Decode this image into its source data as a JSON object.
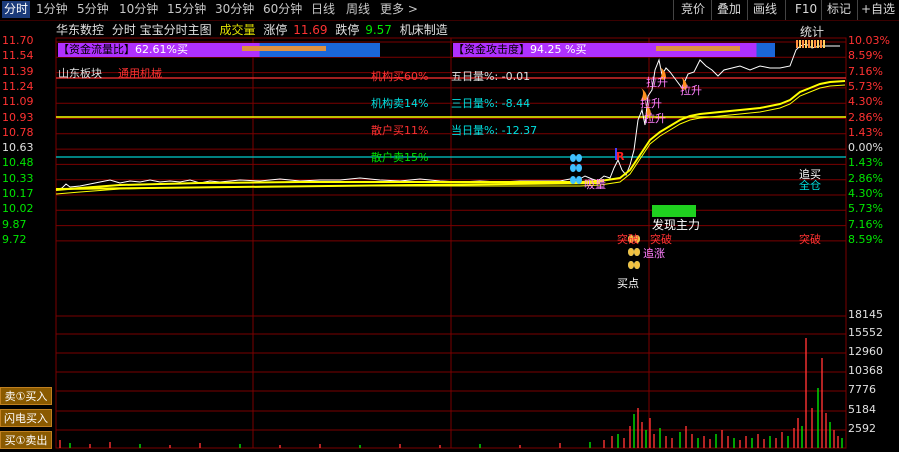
{
  "toolbar": {
    "tabs": [
      "分时",
      "1分钟",
      "5分钟",
      "10分钟",
      "15分钟",
      "30分钟",
      "60分钟",
      "日线",
      "周线",
      "更多 >"
    ],
    "active_tab": "分时",
    "right_buttons": [
      "竞价",
      "叠加",
      "画线",
      "F10",
      "标记",
      "+自选"
    ]
  },
  "title_row": {
    "stock_name": "华东数控",
    "chart_name": "分时 宝宝分时主图",
    "volume_label": "成交量",
    "limit_up_label": "涨停",
    "limit_up_value": "11.69",
    "limit_down_label": "跌停",
    "limit_down_value": "9.57",
    "industry": "机床制造",
    "stats_label": "统计"
  },
  "indicators": {
    "fund_flow_label": "【资金流量比】",
    "fund_flow_value": "62.61%买",
    "fund_attack_label": "【资金攻击度】",
    "fund_attack_value": "94.25 %买",
    "fund_flow_ratio": 0.6261,
    "fund_attack_ratio": 0.9425
  },
  "annotations": {
    "sector": "山东板块",
    "concept": "通用机械",
    "inst_buy": "机构买60%",
    "inst_sell": "机构卖14%",
    "retail_buy": "散户买11%",
    "retail_sell": "散户卖15%",
    "five_day": "五日量%: -0.01",
    "three_day": "三日量%: -8.44",
    "today": "当日量%: -12.37",
    "signal_lashen": "拉升",
    "signal_lashen2": "拉升",
    "signal_lashen3": "拉升",
    "signal_xiliang": "吸量",
    "signal_faxian": "发现主力",
    "signal_tupo": "突破",
    "signal_tupo2": "突破",
    "signal_zhuizhang": "追涨",
    "signal_maidian": "买点",
    "signal_zhuimai": "追买",
    "signal_quancang": "全仓",
    "signal_tupo3": "突破",
    "signal_R": "R"
  },
  "axes": {
    "price_left": [
      "11.70",
      "11.54",
      "11.39",
      "11.24",
      "11.09",
      "10.93",
      "10.78",
      "10.63",
      "10.48",
      "10.33",
      "10.17",
      "10.02",
      "9.87",
      "9.72"
    ],
    "pct_right": [
      "10.03%",
      "8.59%",
      "7.16%",
      "5.73%",
      "4.30%",
      "2.86%",
      "1.43%",
      "0.00%",
      "1.43%",
      "2.86%",
      "4.30%",
      "5.73%",
      "7.16%",
      "8.59%"
    ],
    "volume_right": [
      "18145",
      "15552",
      "12960",
      "10368",
      "7776",
      "5184",
      "2592"
    ]
  },
  "side_buttons": [
    "卖①买入",
    "闪电买入",
    "买①卖出"
  ],
  "colors": {
    "up": "#ff3232",
    "down": "#00e600",
    "grid": "#7a0000",
    "price_line": "#ffffff",
    "avg_line": "#ffff00",
    "accent_cyan": "#00ffff",
    "accent_magenta": "#ff00ff"
  }
}
